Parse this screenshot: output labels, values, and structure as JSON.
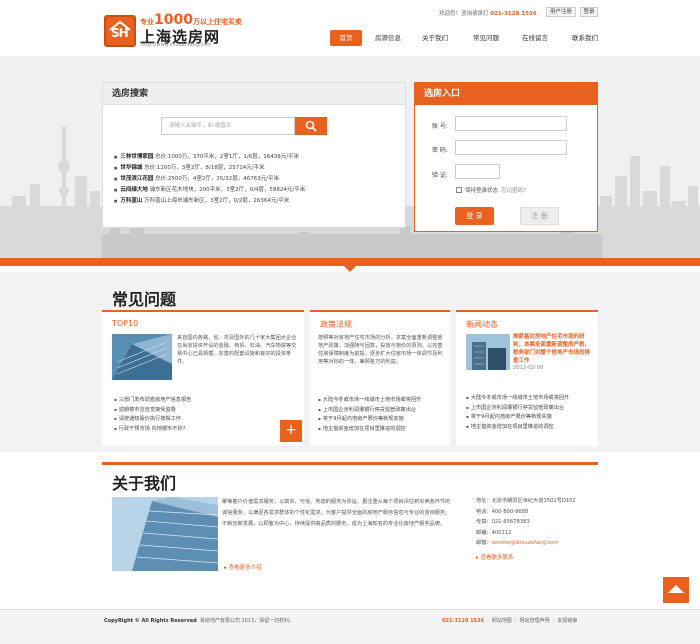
{
  "header": {
    "slogan_prefix": "专业",
    "slogan_number": "1000",
    "slogan_suffix": "万以上住宅买卖",
    "site_title": "上海选房网",
    "site_url": "http://www.shxuanfang.com",
    "logo_text": "SH",
    "welcome": "欢迎您！咨询请拨打",
    "phone": "021-3128 1536",
    "register": "用户注册",
    "login": "登录"
  },
  "nav": [
    {
      "label": "首页",
      "active": true
    },
    {
      "label": "房源信息"
    },
    {
      "label": "关于我们"
    },
    {
      "label": "常见问题"
    },
    {
      "label": "在线留言"
    },
    {
      "label": "联系我们"
    }
  ],
  "search": {
    "title": "选房搜索",
    "placeholder": "请输入关键字，如:楼盘名",
    "listings": [
      {
        "name": "三林世博家园",
        "info": "总价:1000万，370平米，2室1厅，1/6层，16438元/平米"
      },
      {
        "name": "世华锦城",
        "info": "总价:1200万，3室2厅，8/18层，25714元/平米"
      },
      {
        "name": "世茂滨江花园",
        "info": "总价:2500万，4室2厅，25/32层，46763元/平米"
      },
      {
        "name": "云间绿大地",
        "info": "浦东新区花木地块，200平米，3室2厅，0/4层，59824元/平米"
      },
      {
        "name": "万科蓝山",
        "info": "万科蓝山上海市浦东新区，3室2厅，0/2层，26364元/平米"
      }
    ]
  },
  "login": {
    "title": "选房入口",
    "account_label": "账 号:",
    "password_label": "密 码:",
    "captcha_label": "验 证:",
    "remember": "保持登录状态",
    "forgot": "忘记密码?",
    "login_btn": "登 录",
    "register_btn": "注 册"
  },
  "faq": {
    "title": "常见问题",
    "top10": {
      "title": "TOP10",
      "text": "来自国内各路、省、市及国外的几十家大集团大企业在尚京投资开设的金融、商贸、石油、汽车物资等交易中心已具规模。完善的配套设施和良好的投资条件。",
      "items": [
        "三部门发布调查房地产信息报告",
        "逾期楼市应自觉接受监督",
        "请按通知股价执行按揭工作",
        "行政干预市场 内地楼市不妙?"
      ]
    },
    "policy": {
      "title": "政策法规",
      "text": "按照等对房地产住宅市场的分析，本案全面重新调整房地产政策，加强随与回复，投放与物价的原则。以完善住房保障制度为前提，逐步扩大住房市场一体调节及利用等对标的一体，兼顾各方的利益。",
      "items": [
        "大陆今冬或市场一线城市土地市场或将回升",
        "上市国企涉利润遭银行停贷监管政策出台",
        "将于9月起内地房产限价等新规实施",
        "地主借资金增加在项目里推进的调控"
      ]
    },
    "news": {
      "title": "新闻动态",
      "headline": "推薪基对房地产住宅市场的研判，本案全面重新调整房产税，税务部门对整个房地产市场的排查工作",
      "date": "2013-02-08",
      "items": [
        "大陆今冬或市场一线城市土地市场或将回升",
        "上市国企涉利润遭银行停贷监管政策出台",
        "将于9月起内地房产限价等新规实施",
        "地主借资金增加在项目里推进的调控"
      ]
    }
  },
  "about": {
    "title": "关于我们",
    "text": "聚焦客户价值需求服务，以真实、可信、地道的服务为宗旨。更注重从每个项目评估到买卖各环节的诚信服务，以满足各需求群体的个性化需求。为客户提供全面的房地产服务信息与专业的咨询服务。不断创新发展，以顾客为中心，持续提供高品质的服务，成为上海知名的专业化房地产服务品牌。",
    "more": "查看更多介绍",
    "contact": {
      "address": "地址：北京市朝阳区世纪大道1501号D102",
      "tel": "电话：400-800-9688",
      "fax": "传真：021-65678383",
      "postcode": "邮编：400112",
      "email_label": "邮箱：",
      "email": "service@shxuanfang.com",
      "more": "查看更多联系"
    }
  },
  "footer": {
    "copyright_en": "CopyRight © All Rights Reserved",
    "copyright_cn": "易铭地产有限公司 2013，保留一切权利。",
    "phone": "021-3128 1536",
    "links": [
      "网站地图",
      "网站管理声明",
      "友情链接"
    ]
  }
}
